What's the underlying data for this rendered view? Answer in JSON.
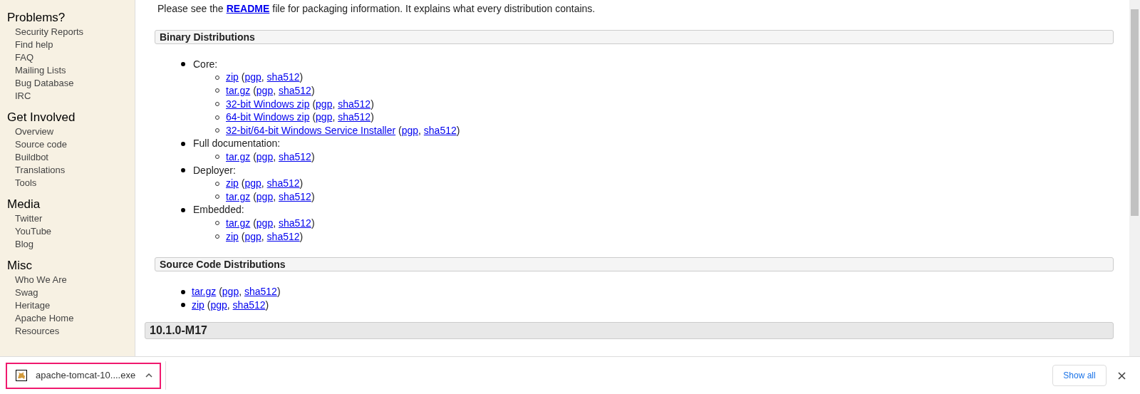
{
  "sidebar": {
    "groups": [
      {
        "title": "Problems?",
        "items": [
          "Security Reports",
          "Find help",
          "FAQ",
          "Mailing Lists",
          "Bug Database",
          "IRC"
        ]
      },
      {
        "title": "Get Involved",
        "items": [
          "Overview",
          "Source code",
          "Buildbot",
          "Translations",
          "Tools"
        ]
      },
      {
        "title": "Media",
        "items": [
          "Twitter",
          "YouTube",
          "Blog"
        ]
      },
      {
        "title": "Misc",
        "items": [
          "Who We Are",
          "Swag",
          "Heritage",
          "Apache Home",
          "Resources"
        ]
      }
    ]
  },
  "intro": {
    "before": "Please see the",
    "link": "README",
    "after": "file for packaging information. It explains what every distribution contains."
  },
  "sections": [
    {
      "title": "Binary Distributions",
      "groups": [
        {
          "label": "Core:",
          "entries": [
            {
              "links": [
                "zip",
                "pgp",
                "sha512"
              ],
              "separators": [
                " (",
                ", ",
                ")"
              ]
            },
            {
              "links": [
                "tar.gz",
                "pgp",
                "sha512"
              ],
              "separators": [
                " (",
                ", ",
                ")"
              ]
            },
            {
              "links": [
                "32-bit Windows zip",
                "pgp",
                "sha512"
              ],
              "separators": [
                " (",
                ", ",
                ")"
              ]
            },
            {
              "links": [
                "64-bit Windows zip",
                "pgp",
                "sha512"
              ],
              "separators": [
                " (",
                ", ",
                ")"
              ]
            },
            {
              "links": [
                "32-bit/64-bit Windows Service Installer",
                "pgp",
                "sha512"
              ],
              "separators": [
                " (",
                ", ",
                ")"
              ]
            }
          ]
        },
        {
          "label": "Full documentation:",
          "entries": [
            {
              "links": [
                "tar.gz",
                "pgp",
                "sha512"
              ],
              "separators": [
                " (",
                ", ",
                ")"
              ]
            }
          ]
        },
        {
          "label": "Deployer:",
          "entries": [
            {
              "links": [
                "zip",
                "pgp",
                "sha512"
              ],
              "separators": [
                " (",
                ", ",
                ")"
              ]
            },
            {
              "links": [
                "tar.gz",
                "pgp",
                "sha512"
              ],
              "separators": [
                " (",
                ", ",
                ")"
              ]
            }
          ]
        },
        {
          "label": "Embedded:",
          "entries": [
            {
              "links": [
                "tar.gz",
                "pgp",
                "sha512"
              ],
              "separators": [
                " (",
                ", ",
                ")"
              ]
            },
            {
              "links": [
                "zip",
                "pgp",
                "sha512"
              ],
              "separators": [
                " (",
                ", ",
                ")"
              ]
            }
          ]
        }
      ]
    },
    {
      "title": "Source Code Distributions",
      "entries": [
        {
          "links": [
            "tar.gz",
            "pgp",
            "sha512"
          ],
          "separators": [
            " (",
            ", ",
            ")"
          ]
        },
        {
          "links": [
            "zip",
            "pgp",
            "sha512"
          ],
          "separators": [
            " (",
            ", ",
            ")"
          ]
        }
      ]
    }
  ],
  "version_header": "10.1.0-M17",
  "download_bar": {
    "file": "apache-tomcat-10....exe",
    "show_all": "Show all"
  }
}
